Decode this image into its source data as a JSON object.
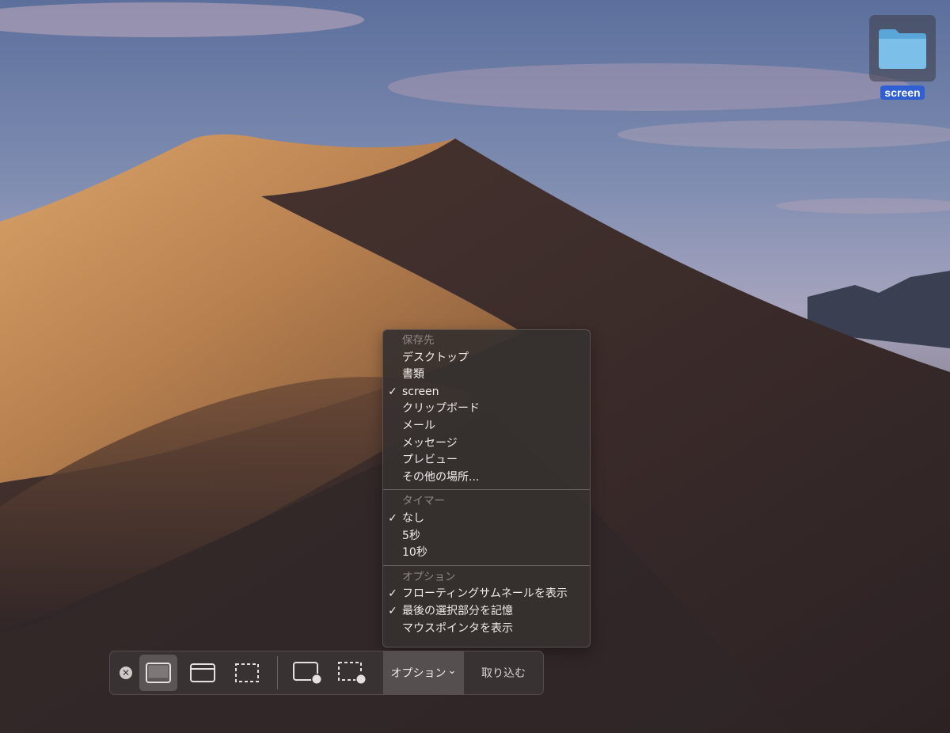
{
  "desktop": {
    "folder": {
      "label": "screen",
      "icon": "folder-icon"
    }
  },
  "options_menu": {
    "save_to": {
      "header": "保存先",
      "items": [
        {
          "label": "デスクトップ",
          "checked": false
        },
        {
          "label": "書類",
          "checked": false
        },
        {
          "label": "screen",
          "checked": true
        },
        {
          "label": "クリップボード",
          "checked": false
        },
        {
          "label": "メール",
          "checked": false
        },
        {
          "label": "メッセージ",
          "checked": false
        },
        {
          "label": "プレビュー",
          "checked": false
        },
        {
          "label": "その他の場所...",
          "checked": false
        }
      ]
    },
    "timer": {
      "header": "タイマー",
      "items": [
        {
          "label": "なし",
          "checked": true
        },
        {
          "label": "5秒",
          "checked": false
        },
        {
          "label": "10秒",
          "checked": false
        }
      ]
    },
    "options": {
      "header": "オプション",
      "items": [
        {
          "label": "フローティングサムネールを表示",
          "checked": true
        },
        {
          "label": "最後の選択部分を記憶",
          "checked": true
        },
        {
          "label": "マウスポインタを表示",
          "checked": false
        }
      ]
    },
    "check_glyph": "✓"
  },
  "toolbar": {
    "close_icon": "close-icon",
    "buttons": [
      {
        "name": "capture-entire-screen",
        "icon": "entire-screen-icon",
        "active": true
      },
      {
        "name": "capture-selected-window",
        "icon": "window-icon",
        "active": false
      },
      {
        "name": "capture-selected-portion",
        "icon": "selection-icon",
        "active": false
      },
      {
        "name": "record-entire-screen",
        "icon": "record-screen-icon",
        "active": false
      },
      {
        "name": "record-selected-portion",
        "icon": "record-selection-icon",
        "active": false
      }
    ],
    "options_label": "オプション",
    "options_chevron": "⌄",
    "capture_label": "取り込む"
  },
  "colors": {
    "folder_label_bg": "#2f5fd0",
    "menu_bg": "#36302f",
    "toolbar_bg": "#3a3434"
  }
}
